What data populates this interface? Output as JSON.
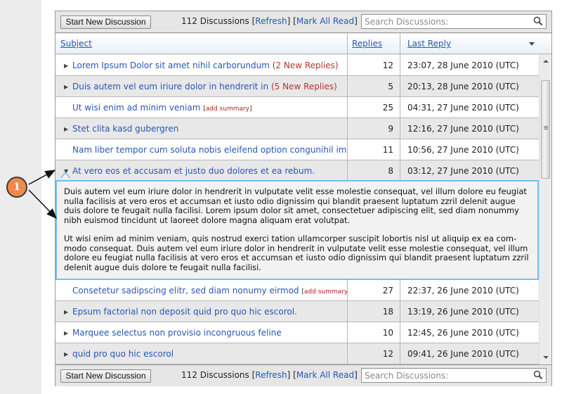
{
  "toolbar": {
    "start_button": "Start New Discussion",
    "count": "112 Discussions",
    "refresh": "Refresh",
    "mark_all_read": "Mark All Read",
    "search_placeholder": "Search Discussions:",
    "search_icon": "search-icon"
  },
  "columns": {
    "subject": "Subject",
    "replies": "Replies",
    "last_reply": "Last Reply",
    "sort_icon": "chevron-down-icon"
  },
  "rows": [
    {
      "title": "Lorem Ipsum Dolor sit amet nihil carborundum",
      "new": "(2 New Replies)",
      "summary": "",
      "replies": "12",
      "last": "23:07, 28 June 2010 (UTC)",
      "toggle": "collapsed"
    },
    {
      "title": "Duis autem vel eum iriure dolor in hendrerit in",
      "new": "(5 New Replies)",
      "summary": "",
      "replies": "5",
      "last": "20:13, 28 June 2010 (UTC)",
      "toggle": "collapsed"
    },
    {
      "title": "Ut wisi enim ad minim veniam",
      "new": "",
      "summary": "add summary",
      "replies": "25",
      "last": "04:31, 27 June 2010 (UTC)",
      "toggle": "none"
    },
    {
      "title": "Stet clita kasd gubergren",
      "new": "",
      "summary": "",
      "replies": "9",
      "last": "12:16, 27 June 2010 (UTC)",
      "toggle": "collapsed"
    },
    {
      "title": "Nam liber tempor cum soluta nobis eleifend option congunihil impe...",
      "new": "",
      "summary": "",
      "replies": "11",
      "last": "10:56, 27 June 2010 (UTC)",
      "toggle": "none"
    },
    {
      "title": "At vero eos et accusam et justo duo dolores et ea rebum.",
      "new": "",
      "summary": "",
      "replies": "8",
      "last": "03:12, 27 June 2010 (UTC)",
      "toggle": "expanded"
    },
    {
      "title": "Consetetur sadipscing elitr, sed diam nonumy eirmod",
      "new": "",
      "summary": "add summary",
      "replies": "27",
      "last": "22:37, 26 June 2010 (UTC)",
      "toggle": "none"
    },
    {
      "title": "Epsum factorial non deposit quid pro quo hic escorol.",
      "new": "",
      "summary": "",
      "replies": "18",
      "last": "13:19, 26 June 2010 (UTC)",
      "toggle": "collapsed"
    },
    {
      "title": "Marquee selectus non provisio incongruous feline",
      "new": "",
      "summary": "",
      "replies": "10",
      "last": "12:45, 26 June 2010 (UTC)",
      "toggle": "collapsed"
    },
    {
      "title": "quid pro quo hic escorol",
      "new": "",
      "summary": "",
      "replies": "12",
      "last": "09:41, 26 June 2010 (UTC)",
      "toggle": "collapsed"
    }
  ],
  "expanded_summary": {
    "paragraphs": [
      "Duis autem vel eum iriure dolor in hendrerit in vulputate velit esse molestie consequat, vel illum dolore eu feugiat nulla facilisis at vero eros et accumsan et iusto odio dignissim qui blandit praesent luptatum zzril delenit augue duis dolore te feugait nulla facilisi. Lorem ipsum dolor sit amet, consectetuer adipiscing elit, sed diam nonummy nibh euismod tincidunt ut laoreet dolore magna aliquam erat volutpat.",
      "Ut wisi enim ad minim veniam, quis nostrud exerci tation ullamcorper suscipit lobortis nisl ut aliquip ex ea com-modo consequat. Duis autem vel eum iriure dolor in hendrerit in vulputate velit esse molestie consequat, vel illum dolore eu feugiat nulla facilisis at vero eros et accumsan et iusto odio dignissim qui blandit praesent luptatum zzril delenit augue duis dolore te feugait nulla facilisi."
    ]
  },
  "callout": {
    "number": "1"
  },
  "colors": {
    "link": "#2a55b5",
    "new_replies": "#b83333",
    "add_summary": "#b52020",
    "expanded_border": "#71c1ea",
    "callout_fill": "#f08a4b"
  }
}
